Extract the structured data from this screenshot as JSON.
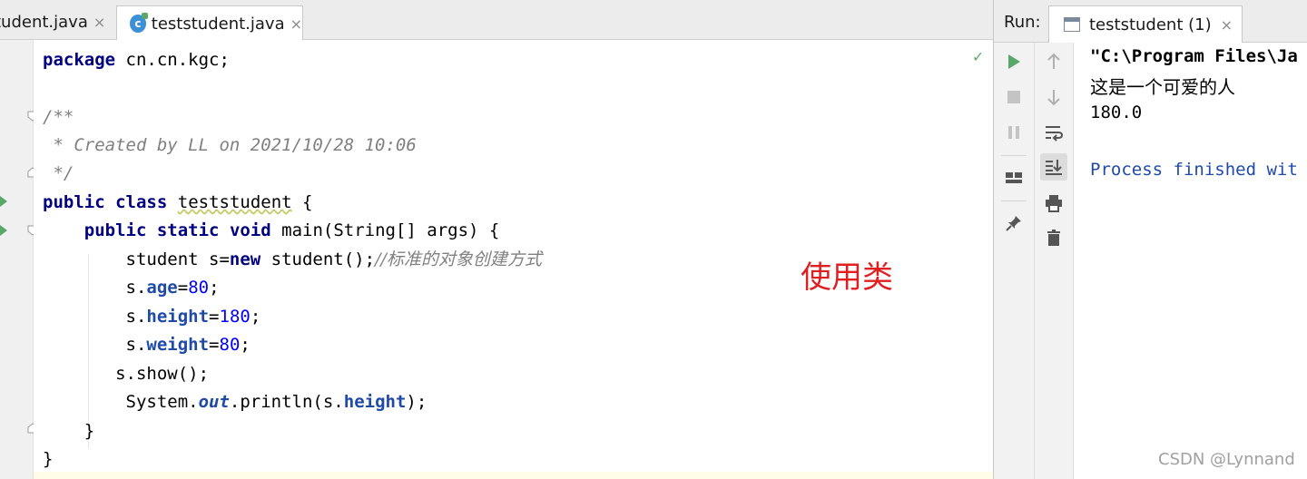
{
  "editor_tabs": [
    {
      "label": "tudent.java",
      "close": "×"
    },
    {
      "label": "teststudent.java",
      "close": "×",
      "icon": "c"
    }
  ],
  "code_lines": {
    "l1": {
      "kw": "package",
      "rest": " cn.cn.kgc;"
    },
    "l3": "/**",
    "l4": " * Created by LL on 2021/10/28 10:06",
    "l5": " */",
    "l6": {
      "kw1": "public",
      "kw2": "class",
      "name": "teststudent",
      "rest": " {"
    },
    "l7": {
      "indent": "    ",
      "kw1": "public",
      "kw2": "static",
      "kw3": "void",
      "rest": " main(String[] args) {"
    },
    "l8": {
      "indent": "        ",
      "pre": "student s=",
      "kw": "new",
      "post": " student();",
      "comment": "//标准的对象创建方式"
    },
    "l9": {
      "indent": "        ",
      "pre": "s.",
      "field": "age",
      "eq": "=",
      "num": "80",
      "end": ";"
    },
    "l10": {
      "indent": "        ",
      "pre": "s.",
      "field": "height",
      "eq": "=",
      "num": "180",
      "end": ";"
    },
    "l11": {
      "indent": "        ",
      "pre": "s.",
      "field": "weight",
      "eq": "=",
      "num": "80",
      "end": ";"
    },
    "l12": {
      "indent": "       ",
      "text": "s.show();"
    },
    "l13": {
      "indent": "        ",
      "pre": "System.",
      "stat": "out",
      "mid": ".println(s.",
      "field": "height",
      "end": ");"
    },
    "l14": {
      "indent": "    ",
      "text": "}"
    },
    "l15": "}"
  },
  "annotation": "使用类",
  "run_panel": {
    "label": "Run:",
    "tab_label": "teststudent (1)",
    "tab_close": "×"
  },
  "console_lines": [
    "\"C:\\Program Files\\Ja",
    "这是一个可爱的人",
    "180.0",
    "Process finished wit"
  ],
  "watermark": "CSDN @Lynnand",
  "colors": {
    "keyword": "#000080",
    "number": "#0000ff",
    "field": "#1f4aa8",
    "comment": "#808080",
    "annotation": "#e02020",
    "run_green": "#59a869"
  }
}
